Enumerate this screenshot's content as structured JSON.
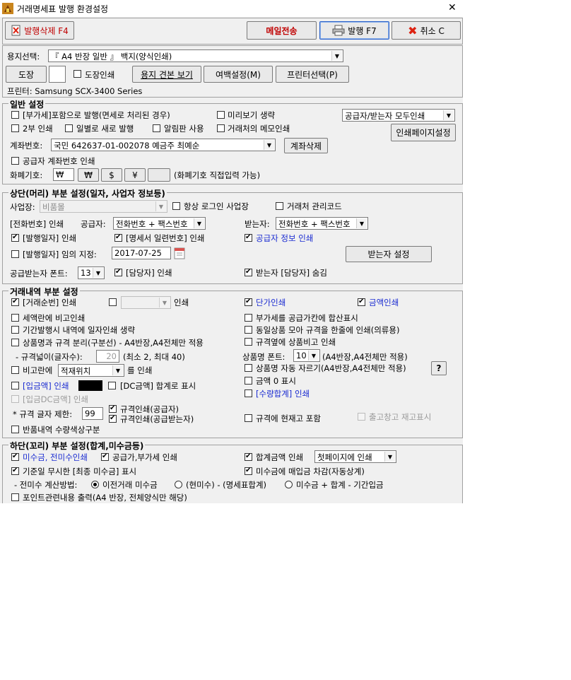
{
  "window": {
    "title": "거래명세표 발행 환경설정",
    "close": "✕"
  },
  "toolbar": {
    "delete": "발행삭제 F4",
    "email": "메일전송",
    "print": "발행 F7",
    "cancel": "취소 C"
  },
  "paper": {
    "label": "용지선택:",
    "value": "『 A4 반장 일반 』 백지(양식인쇄)",
    "stamp": "도장",
    "stamp_print": "도장인쇄",
    "sample": "용지 견본 보기",
    "margin": "여백설정(M)",
    "printer_select": "프린터선택(P)",
    "printer_info": "프린터: Samsung SCX-3400 Series"
  },
  "general": {
    "title": "일반 설정",
    "vat_inclusive": "[부가세]포함으로 발행(면세로 처리된 경우)",
    "preview_skip": "미리보기 생략",
    "supplier_combo": "공급자/받는자 모두인쇄",
    "two_copies": "2부 인쇄",
    "daily_new": "일별로 새로 발행",
    "notice_use": "알림판 사용",
    "memo_print": "거래처의 메모인쇄",
    "print_page_setup": "인쇄페이지설정",
    "account_label": "계좌번호:",
    "account_value": "국민 642637-01-002078 예금주 최예순",
    "account_delete": "계좌삭제",
    "supplier_account": "공급자 계좌번호 인쇄",
    "currency_label": "화폐기호:",
    "currency_value": "₩",
    "currency_btn1": "₩",
    "currency_btn2": "$",
    "currency_btn3": "¥",
    "currency_note": "(화폐기호 직접입력 가능)"
  },
  "header": {
    "title": "상단(머리) 부분 설정(일자, 사업자 정보등)",
    "biz_label": "사업장:",
    "biz_value": "비품몰",
    "always_logo": "항상 로그인 사업장",
    "client_code": "거래처 관리코드",
    "phone_label": "[전화번호] 인쇄",
    "supplier_label": "공급자:",
    "supplier_value": "전화번호 + 팩스번호",
    "receiver_label": "받는자:",
    "receiver_value": "전화번호 + 팩스번호",
    "issue_date": "[발행일자] 인쇄",
    "serial": "[명세서 일련번호] 인쇄",
    "supplier_info": "공급자 정보 인쇄",
    "any_date": "[발행일자] 임의 지정:",
    "date_value": "2017-07-25",
    "receiver_setup": "받는자 설정",
    "font_label": "공급받는자 폰트:",
    "font_value": "13",
    "manager_print": "[담당자] 인쇄",
    "receiver_manager_hide": "받는자 [담당자] 숨김"
  },
  "detail": {
    "title": "거래내역 부분 설정",
    "seq": "[거래순번] 인쇄",
    "print_suffix": "인쇄",
    "unit_price": "단가인쇄",
    "amount": "금액인쇄",
    "tax_remark": "세액란에 비고인쇄",
    "vat_sum": "부가세를 공급가칸에 합산표시",
    "period_skip": "기간발행시 내역에 일자인쇄 생략",
    "same_goods": "동일상품 모아 규격을 한줄에 인쇄(의류용)",
    "split": "상품명과 규격 분리(구분선) - A4반장,A4전체만 적용",
    "spec_remark": "규격옆에 상품비고 인쇄",
    "spec_width_label": "- 규격넓이(글자수):",
    "spec_width_value": "20",
    "spec_width_note": "(최소 2, 최대 40)",
    "goods_font_label": "상품명 폰트:",
    "goods_font_value": "10",
    "goods_font_note": "(A4반장,A4전체만 적용)",
    "remark_pre": "비고란에",
    "remark_value": "적재위치",
    "remark_post": "를 인쇄",
    "auto_cut": "상품명 자동 자르기(A4반장,A4전체만 적용)",
    "help": "?",
    "zero_amount": "금액 0 표시",
    "deposit": "[입금액] 인쇄",
    "dc_sum": "[DC금액] 합계로 표시",
    "qty_total": "[수량합계] 인쇄",
    "dc_deposit": "[입금DC금액] 인쇄",
    "spec_limit_label": "* 규격 글자 제한:",
    "spec_limit_value": "99",
    "spec_supplier": "규격인쇄(공급자)",
    "spec_receiver": "규격인쇄(공급받는자)",
    "stock_include": "규격에 현재고 포함",
    "outbound_stock": "출고창고 재고표시",
    "return_color": "반품내역 수량색상구분"
  },
  "footer": {
    "title": "하단(꼬리) 부분 설정(합계,미수금등)",
    "receivable": "미수금, 전미수인쇄",
    "supply_vat": "공급가,부가세 인쇄",
    "total_print": "합계금액 인쇄",
    "first_page": "첫페이지에 인쇄",
    "ignore_base": "기준일 무시한 [최종 미수금] 표시",
    "deduct": "미수금에 매입금 차감(자동상계)",
    "calc_label": "- 전미수 계산방법:",
    "calc_opt1": "이전거래 미수금",
    "calc_opt2": "(현미수) - (명세표합계)",
    "calc_opt3": "미수금 + 합계 - 기간입금",
    "points": "포인트관련내용 출력(A4 반장, 전체양식만 해당)"
  },
  "colors": {
    "blue_text": "#1a2bd1",
    "email_red": "#c00000",
    "deposit_swatch": "#000000"
  }
}
